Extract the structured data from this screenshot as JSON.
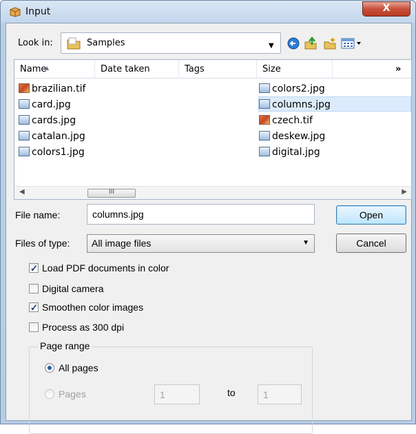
{
  "window": {
    "title": "Input",
    "close_glyph": "X"
  },
  "toolbar": {
    "look_in_label": "Look in:",
    "look_in_value": "Samples",
    "icons": [
      "folder-icon",
      "back-icon",
      "up-folder-icon",
      "new-folder-icon",
      "view-menu-icon"
    ]
  },
  "file_list": {
    "columns": [
      "Name",
      "Date taken",
      "Tags",
      "Size"
    ],
    "more_columns": "»",
    "files_left": [
      "brazilian.tif",
      "card.jpg",
      "cards.jpg",
      "catalan.jpg",
      "colors1.jpg"
    ],
    "files_right": [
      "colors2.jpg",
      "columns.jpg",
      "czech.tif",
      "deskew.jpg",
      "digital.jpg"
    ],
    "selected_file": "columns.jpg",
    "scroll_thumb_glyph": "III"
  },
  "form": {
    "file_name_label": "File name:",
    "file_name_value": "columns.jpg",
    "files_of_type_label": "Files of type:",
    "files_of_type_value": "All image files",
    "open_label": "Open",
    "cancel_label": "Cancel"
  },
  "options": [
    {
      "label": "Load PDF documents in color",
      "checked": true
    },
    {
      "label": "Digital camera",
      "checked": false
    },
    {
      "label": "Smoothen color images",
      "checked": true
    },
    {
      "label": "Process as 300 dpi",
      "checked": false
    }
  ],
  "page_range": {
    "title": "Page range",
    "all_pages_label": "All pages",
    "pages_label": "Pages",
    "from_value": "1",
    "to_label": "to",
    "to_value": "1"
  },
  "colors": {
    "selection": "#dcebfb",
    "titlebar": "#c2d6ec",
    "close_button": "#c8503a"
  }
}
